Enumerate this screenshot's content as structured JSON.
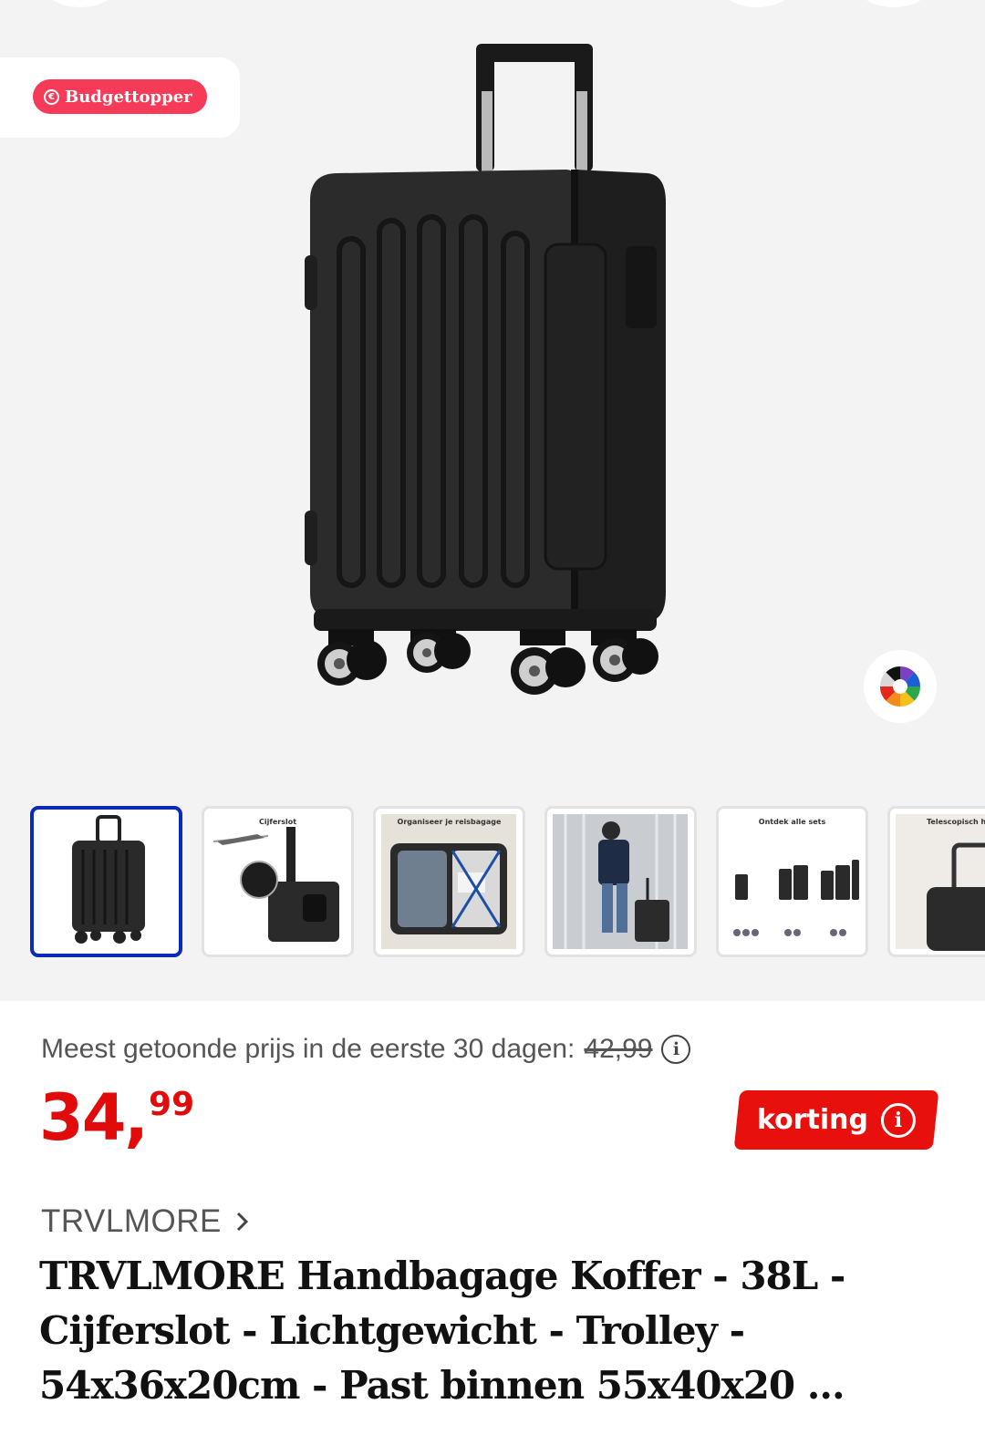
{
  "badge": {
    "label": "Budgettopper",
    "icon": "euro-coin-icon"
  },
  "gallery": {
    "thumbnails": [
      {
        "caption": ""
      },
      {
        "caption": "Cijferslot"
      },
      {
        "caption": "Organiseer je reisbagage"
      },
      {
        "caption": ""
      },
      {
        "caption": "Ontdek alle sets"
      },
      {
        "caption": "Telescopisch h"
      }
    ]
  },
  "price": {
    "prior_label": "Meest getoonde prijs in de eerste 30 dagen:",
    "prior_value": "42,99",
    "main": "34",
    "separator": ",",
    "cents": "99",
    "discount_label": "korting"
  },
  "product": {
    "brand": "TRVLMORE",
    "title": "TRVLMORE Handbagage Koffer - 38L - Cijferslot - Lichtgewicht - Trolley - 54x36x20cm - Past binnen 55x40x20 ..."
  },
  "colors": {
    "accent_red": "#e8100c",
    "badge_pink": "#f53b57",
    "active_thumb_border": "#0a2ab8"
  }
}
